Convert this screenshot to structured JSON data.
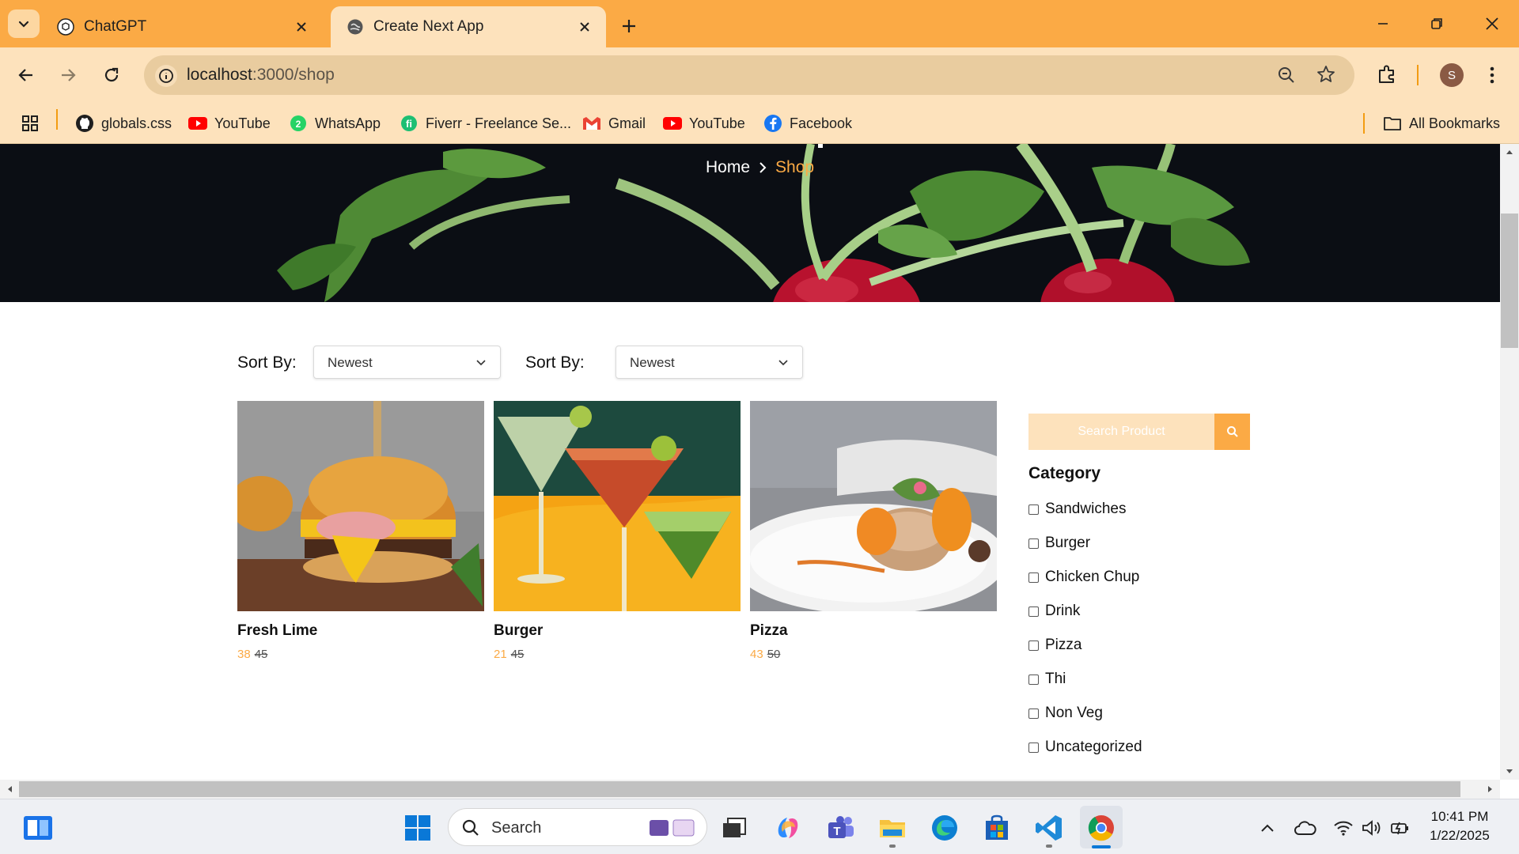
{
  "browser": {
    "tabs": [
      {
        "title": "ChatGPT",
        "active": false
      },
      {
        "title": "Create Next App",
        "active": true
      }
    ],
    "url_host": "localhost",
    "url_path": ":3000/shop",
    "bookmarks": [
      {
        "label": "globals.css",
        "icon": "github-icon"
      },
      {
        "label": "YouTube",
        "icon": "youtube-icon"
      },
      {
        "label": "WhatsApp",
        "icon": "whatsapp-icon"
      },
      {
        "label": "Fiverr - Freelance Se...",
        "icon": "fiverr-icon"
      },
      {
        "label": "Gmail",
        "icon": "gmail-icon"
      },
      {
        "label": "YouTube",
        "icon": "youtube-icon"
      },
      {
        "label": "Facebook",
        "icon": "facebook-icon"
      }
    ],
    "all_bookmarks": "All Bookmarks",
    "profile_initial": "S",
    "colors": {
      "tabstrip": "#fbaa45",
      "toolbar": "#fde2bc"
    }
  },
  "page": {
    "breadcrumb": {
      "home": "Home",
      "current": "Shop"
    },
    "sort": [
      {
        "label": "Sort By:",
        "value": "Newest"
      },
      {
        "label": "Sort By:",
        "value": "Newest"
      }
    ],
    "products": [
      {
        "name": "Fresh Lime",
        "price": "38",
        "old_price": "45",
        "image": "burger-photo"
      },
      {
        "name": "Burger",
        "price": "21",
        "old_price": "45",
        "image": "cocktails-photo"
      },
      {
        "name": "Pizza",
        "price": "43",
        "old_price": "50",
        "image": "plated-dish-photo"
      }
    ],
    "search": {
      "placeholder": "Search Product"
    },
    "category_title": "Category",
    "categories": [
      "Sandwiches",
      "Burger",
      "Chicken Chup",
      "Drink",
      "Pizza",
      "Thi",
      "Non Veg",
      "Uncategorized"
    ],
    "accent_color": "#fbaa45"
  },
  "taskbar": {
    "search_label": "Search",
    "time": "10:41 PM",
    "date": "1/22/2025"
  }
}
